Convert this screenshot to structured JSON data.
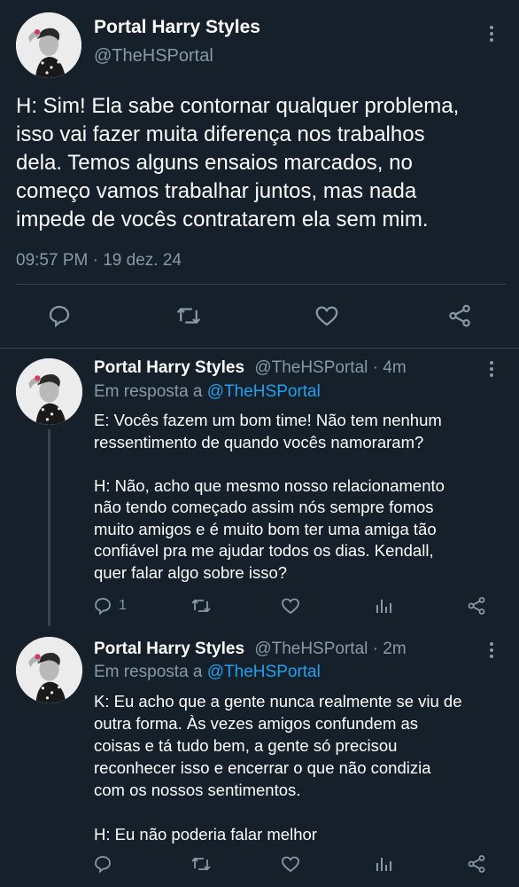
{
  "main_tweet": {
    "display_name": "Portal Harry Styles",
    "handle": "@TheHSPortal",
    "text": "H: Sim! Ela sabe contornar qualquer problema,\nisso vai fazer muita diferença nos trabalhos\ndela. Temos alguns ensaios marcados, no\ncomeço vamos trabalhar juntos, mas nada\nimpede de vocês contratarem ela sem mim.",
    "timestamp": "09:57 PM · 19 dez. 24"
  },
  "replies": [
    {
      "display_name": "Portal Harry Styles",
      "handle": "@TheHSPortal",
      "time": "· 4m",
      "reply_prefix": "Em resposta a",
      "reply_to": "@TheHSPortal",
      "text": "E: Vocês fazem um bom time! Não tem nenhum\nressentimento de quando vocês namoraram?\n\nH: Não, acho que mesmo nosso relacionamento\nnão tendo começado assim nós sempre fomos\nmuito amigos e é muito bom ter uma amiga tão\nconfiável pra me ajudar todos os dias. Kendall,\nquer falar algo sobre isso?",
      "reply_count": "1"
    },
    {
      "display_name": "Portal Harry Styles",
      "handle": "@TheHSPortal",
      "time": "· 2m",
      "reply_prefix": "Em resposta a",
      "reply_to": "@TheHSPortal",
      "text": "K: Eu acho que a gente nunca realmente se viu de\noutra forma. Às vezes amigos confundem as\ncoisas e tá tudo bem, a gente só precisou\nreconhecer isso e encerrar o que não condizia\ncom os nossos sentimentos.\n\nH: Eu não poderia falar melhor",
      "reply_count": ""
    }
  ],
  "icons": [
    "reply-icon",
    "retweet-icon",
    "like-icon",
    "share-icon",
    "analytics-icon",
    "more-icon"
  ],
  "colors": {
    "background": "#15202b",
    "muted": "#8899a6",
    "link": "#1da1f2",
    "divider": "#38444d"
  }
}
